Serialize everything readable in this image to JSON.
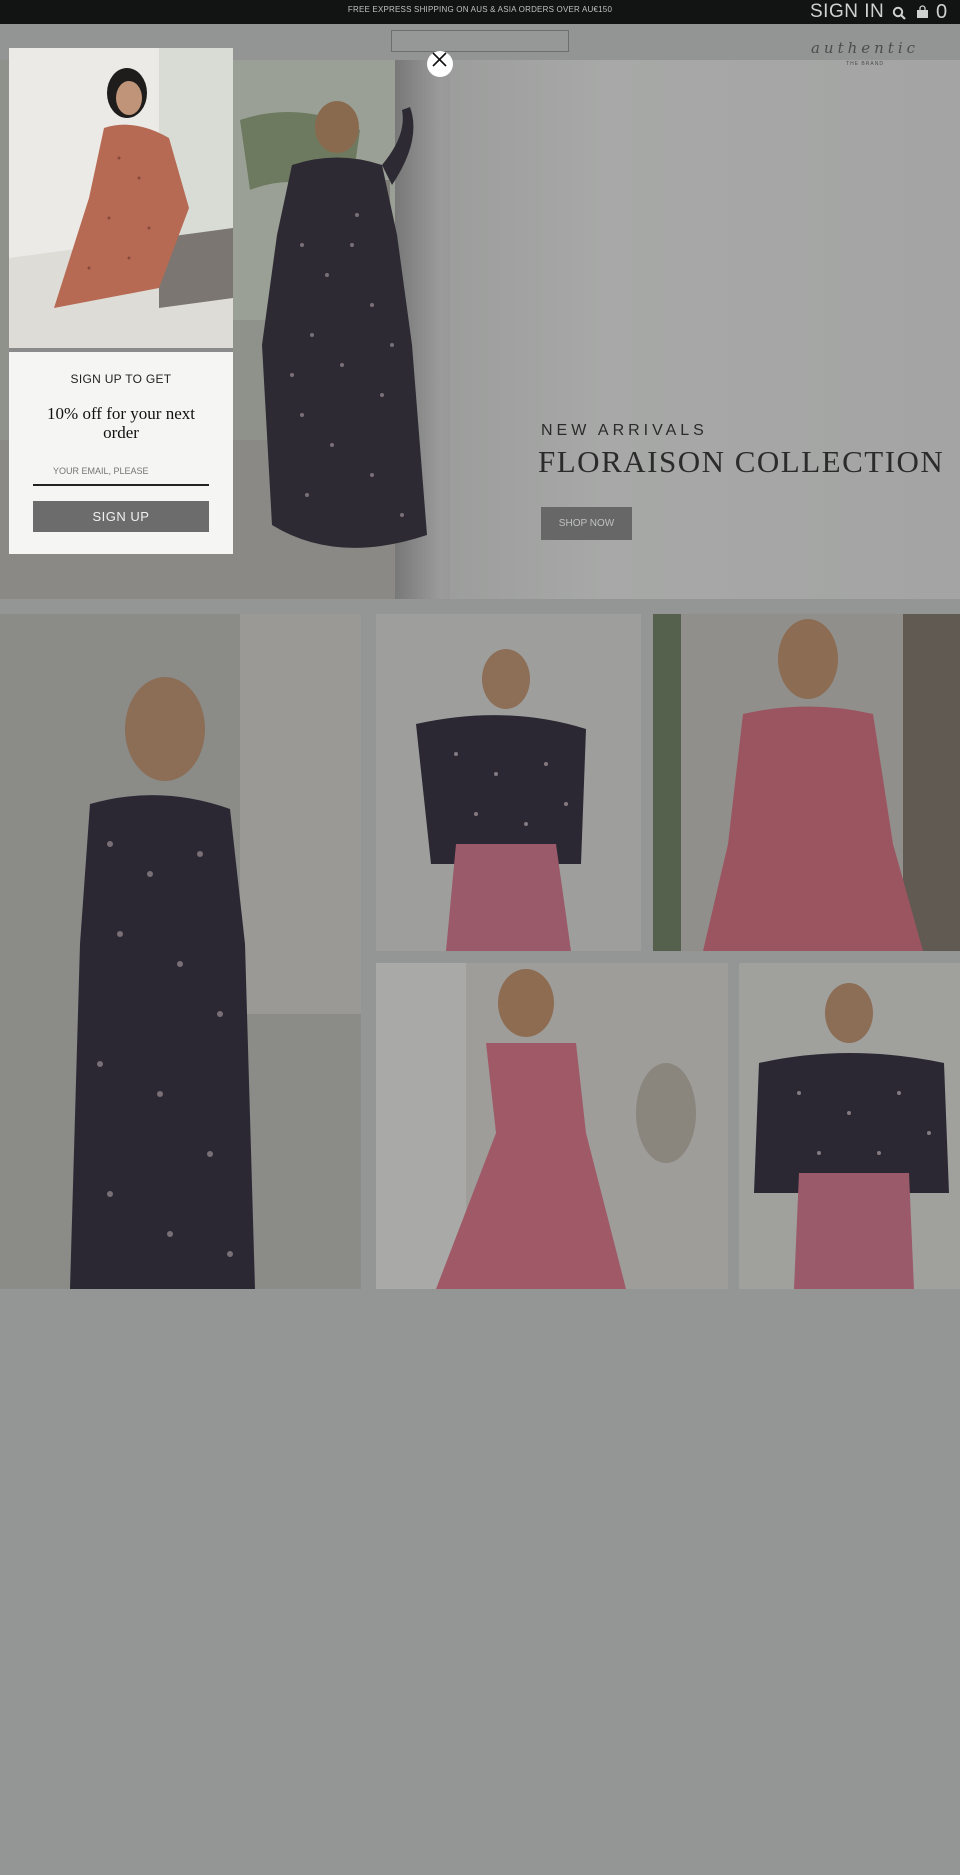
{
  "topbar": {
    "promo": "FREE EXPRESS SHIPPING ON AUS & ASIA ORDERS OVER AU€150",
    "signin": "SIGN IN",
    "cart_count": "0",
    "icons": [
      "search-icon",
      "bag-icon"
    ]
  },
  "brand": {
    "logo_text": "authentic",
    "logo_sub": "THE BRAND"
  },
  "hero": {
    "kicker": "NEW ARRIVALS",
    "title": "FLORAISON COLLECTION",
    "cta": "SHOP NOW"
  },
  "popup": {
    "heading": "SIGN UP TO GET",
    "offer": "10% off for your next order",
    "email_placeholder": "YOUR EMAIL, PLEASE",
    "submit": "SIGN UP",
    "close_icon": "close-icon"
  },
  "colors": {
    "overlay": "#949695",
    "topbar": "#121313",
    "button": "#666766",
    "popup_bg": "#f5f5f4"
  }
}
